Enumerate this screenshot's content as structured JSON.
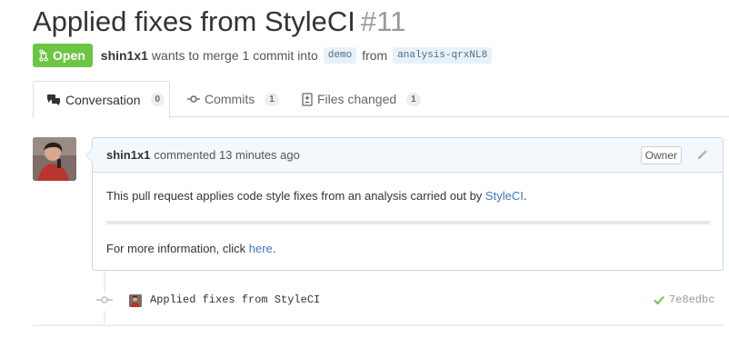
{
  "pull_request": {
    "title": "Applied fixes from StyleCI",
    "number": "#11",
    "state": "Open",
    "author": "shin1x1",
    "merge_text": "wants to merge 1 commit into",
    "base_branch": "demo",
    "from_text": "from",
    "head_branch": "analysis-qrxNL8"
  },
  "tabs": [
    {
      "label": "Conversation",
      "count": "0",
      "icon": "comment-discussion-icon",
      "selected": true
    },
    {
      "label": "Commits",
      "count": "1",
      "icon": "git-commit-icon",
      "selected": false
    },
    {
      "label": "Files changed",
      "count": "1",
      "icon": "diff-icon",
      "selected": false
    }
  ],
  "comment": {
    "author": "shin1x1",
    "action": "commented 13 minutes ago",
    "badge": "Owner",
    "body_prefix": "This pull request applies code style fixes from an analysis carried out by ",
    "body_link": "StyleCI",
    "body_suffix": ".",
    "info_prefix": "For more information, click ",
    "info_link": "here",
    "info_suffix": "."
  },
  "commit": {
    "message": "Applied fixes from StyleCI",
    "sha": "7e8edbc",
    "status": "success"
  },
  "colors": {
    "open_green": "#6cc644",
    "link_blue": "#4078c0",
    "header_bg": "#f3f8fc",
    "check_green": "#6cc644"
  }
}
